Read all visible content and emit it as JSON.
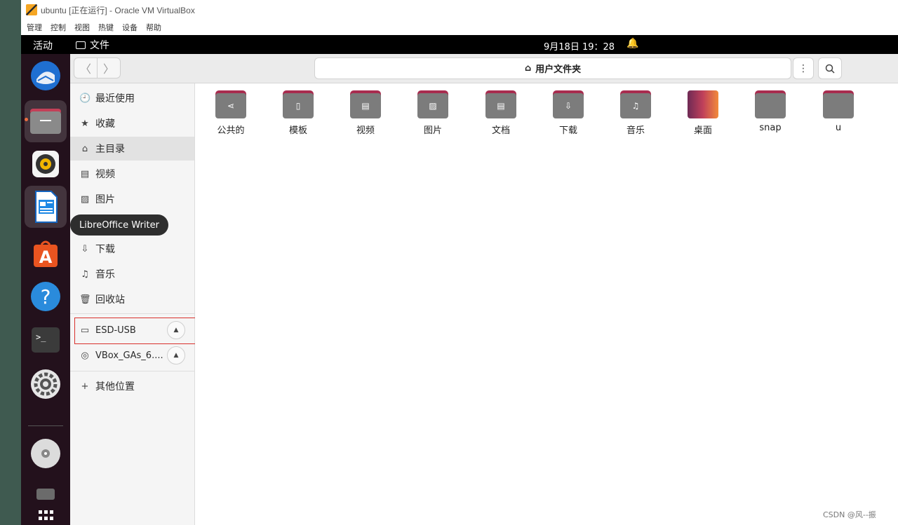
{
  "vbox": {
    "title": "ubuntu [正在运行] - Oracle VM VirtualBox",
    "menus": [
      "管理",
      "控制",
      "视图",
      "热键",
      "设备",
      "帮助"
    ]
  },
  "topbar": {
    "activities": "活动",
    "app_menu": "文件",
    "clock": "9月18日  19：28"
  },
  "header": {
    "location": "用户文件夹",
    "back_glyph": "〈",
    "forward_glyph": "〉",
    "menu_glyph": "⋮",
    "search_glyph": "🔍"
  },
  "sidebar": {
    "items": [
      {
        "label": "最近使用",
        "icon": "clock-icon",
        "glyph": "🕘"
      },
      {
        "label": "收藏",
        "icon": "star-icon",
        "glyph": "★"
      },
      {
        "label": "主目录",
        "icon": "home-icon",
        "glyph": "⌂"
      },
      {
        "label": "视频",
        "icon": "video-icon",
        "glyph": "▤"
      },
      {
        "label": "图片",
        "icon": "image-icon",
        "glyph": "▨"
      },
      {
        "label": "下载",
        "icon": "download-icon",
        "glyph": "⇩"
      },
      {
        "label": "音乐",
        "icon": "music-icon",
        "glyph": "♫"
      },
      {
        "label": "回收站",
        "icon": "trash-icon",
        "glyph": "🗑"
      }
    ],
    "devices": [
      {
        "label": "ESD-USB",
        "icon": "drive-icon",
        "glyph": "▭"
      },
      {
        "label": "VBox_GAs_6....",
        "icon": "disc-icon",
        "glyph": "◎"
      }
    ],
    "other_locations": "其他位置",
    "plus_glyph": "+",
    "eject_glyph": "▲"
  },
  "tooltip": "LibreOffice Writer",
  "folders": [
    {
      "label": "公共的",
      "icon": "share-icon",
      "glyph": "⋖"
    },
    {
      "label": "模板",
      "icon": "template-icon",
      "glyph": "▯"
    },
    {
      "label": "视频",
      "icon": "video-icon",
      "glyph": "▤"
    },
    {
      "label": "图片",
      "icon": "image-icon",
      "glyph": "▨"
    },
    {
      "label": "文档",
      "icon": "document-icon",
      "glyph": "▤"
    },
    {
      "label": "下载",
      "icon": "download-icon",
      "glyph": "⇩"
    },
    {
      "label": "音乐",
      "icon": "music-icon",
      "glyph": "♫"
    },
    {
      "label": "桌面",
      "icon": "desktop-icon",
      "glyph": ""
    },
    {
      "label": "snap",
      "icon": "folder-icon",
      "glyph": ""
    },
    {
      "label": "u",
      "icon": "folder-icon",
      "glyph": ""
    }
  ],
  "watermark": "CSDN @风--振",
  "colors": {
    "accent": "#e95420",
    "folder_tab": "#a82c4f",
    "folder_body": "#7c7c7c",
    "dock": "#23111c",
    "highlight_box": "#d9302c"
  }
}
